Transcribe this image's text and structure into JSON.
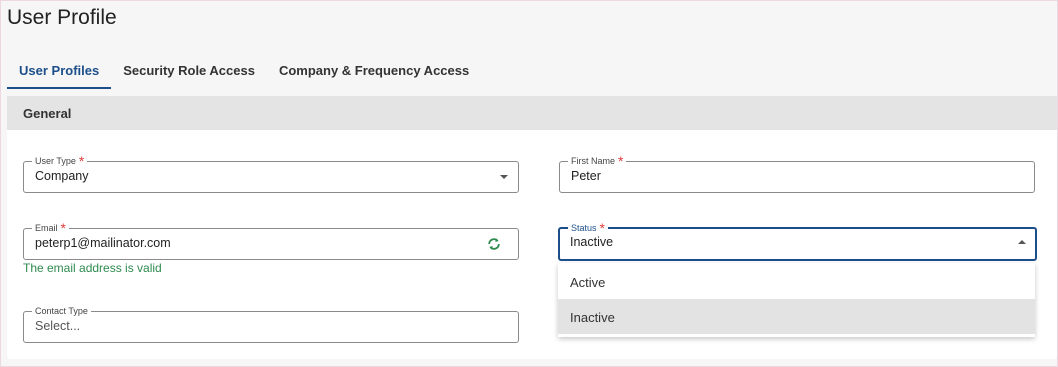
{
  "page": {
    "title": "User Profile"
  },
  "tabs": [
    {
      "label": "User Profiles",
      "active": true
    },
    {
      "label": "Security Role Access",
      "active": false
    },
    {
      "label": "Company & Frequency Access",
      "active": false
    }
  ],
  "section": {
    "title": "General"
  },
  "form": {
    "user_type": {
      "label": "User Type",
      "required": "*",
      "value": "Company"
    },
    "first_name": {
      "label": "First Name",
      "required": "*",
      "value": "Peter"
    },
    "email": {
      "label": "Email",
      "required": "*",
      "value": "peterp1@mailinator.com",
      "helper": "The email address is valid",
      "icon": "refresh-icon"
    },
    "status": {
      "label": "Status",
      "required": "*",
      "value": "Inactive",
      "open": true
    },
    "contact_type": {
      "label": "Contact Type",
      "placeholder": "Select..."
    }
  },
  "status_menu": {
    "options": [
      {
        "label": "Active",
        "selected": false
      },
      {
        "label": "Inactive",
        "selected": true
      }
    ]
  },
  "colors": {
    "accent": "#1c4f8a",
    "required": "#e03a3a",
    "valid": "#2e8b4f",
    "section_header_bg": "#e4e4e4",
    "selected_option_bg": "#e3e3e3"
  }
}
